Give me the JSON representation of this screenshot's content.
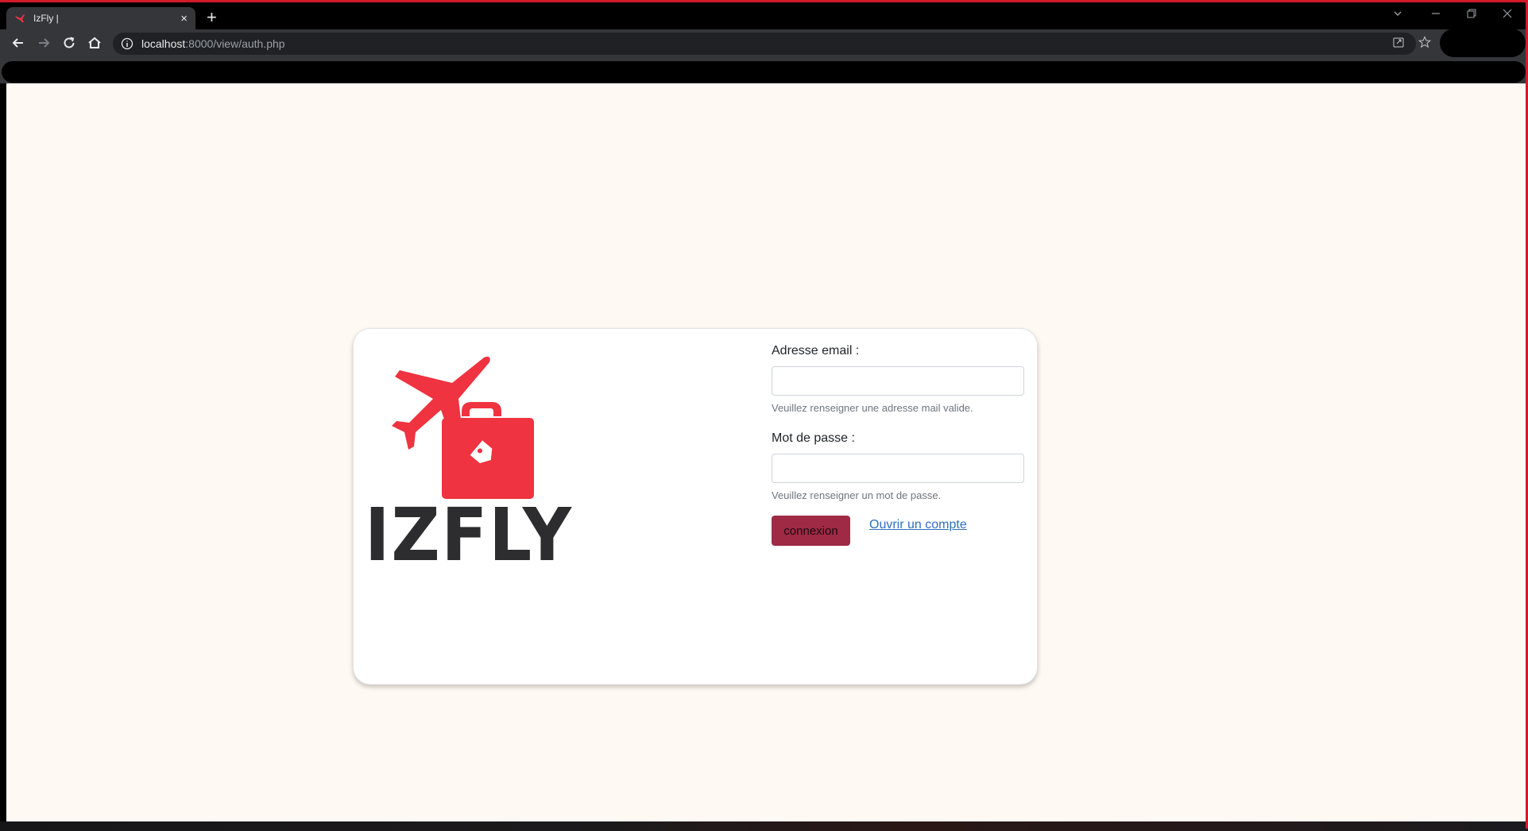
{
  "browser": {
    "tab_title": "IzFly |",
    "tab_close": "×",
    "new_tab": "+",
    "url_host": "localhost",
    "url_path": ":8000/view/auth.php"
  },
  "login": {
    "brand": "IZFLY",
    "email_label": "Adresse email :",
    "email_value": "",
    "email_help": "Veuillez renseigner une adresse mail valide.",
    "password_label": "Mot de passe :",
    "password_value": "",
    "password_help": "Veuillez renseigner un mot de passe.",
    "submit_label": "connexion",
    "register_link": "Ouvrir un compte"
  },
  "colors": {
    "brand_red": "#ef3340",
    "button_bg": "#9e2a45",
    "link": "#2f6fbe",
    "page_bg": "#fff9f3"
  }
}
